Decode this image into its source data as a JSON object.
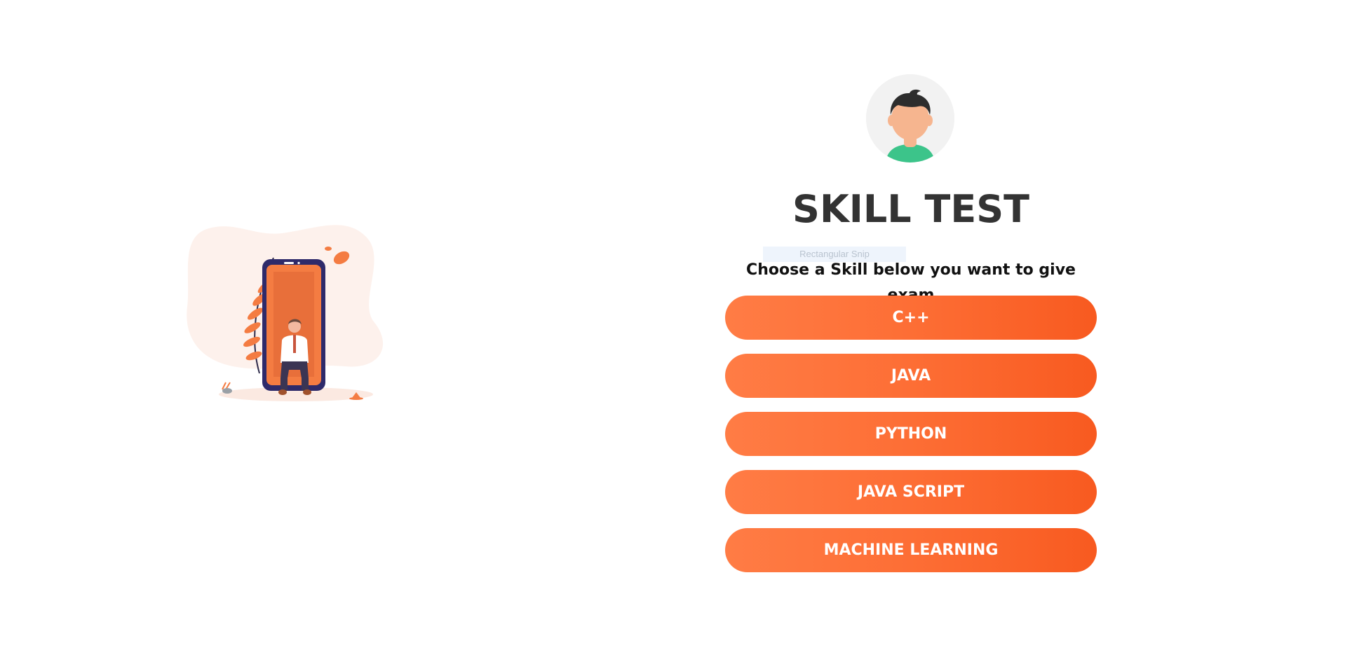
{
  "illustration": {
    "icon": "person-sitting-phone-illustration"
  },
  "profile": {
    "icon": "user-avatar-icon"
  },
  "header": {
    "title": "SKILL TEST",
    "subtitle": "Choose a Skill below you want to give exam"
  },
  "overlay": {
    "snip_label": "Rectangular Snip"
  },
  "skills": [
    {
      "label": "C++"
    },
    {
      "label": "JAVA"
    },
    {
      "label": "PYTHON"
    },
    {
      "label": "JAVA SCRIPT"
    },
    {
      "label": "MACHINE LEARNING"
    }
  ],
  "colors": {
    "accent_start": "#ff7c45",
    "accent_end": "#f85a20",
    "title": "#333333",
    "avatar_bg": "#f2f2f2"
  }
}
